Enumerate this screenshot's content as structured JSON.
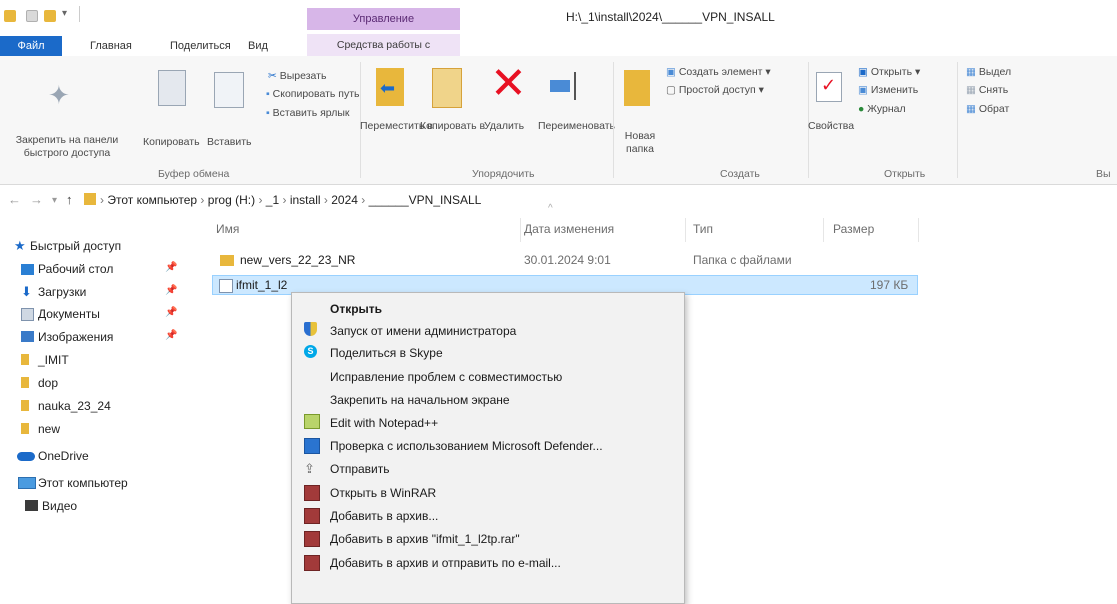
{
  "colors": {
    "accent": "#1b6ac9",
    "context_tab": "#d7b6e8",
    "selection": "#cce8ff",
    "folder": "#e8b73c",
    "delete_red": "#e81123"
  },
  "titlebar": {
    "context_tab_header": "Управление",
    "window_title": "H:\\_1\\install\\2024\\______VPN_INSALL"
  },
  "ribbon_tabs": {
    "file": "Файл",
    "home": "Главная",
    "share": "Поделиться",
    "view": "Вид",
    "app_tools": "Средства работы с приложениями"
  },
  "ribbon": {
    "clipboard": {
      "pin_quick_access": "Закрепить на панели быстрого доступа",
      "copy": "Копировать",
      "paste": "Вставить",
      "cut": "Вырезать",
      "copy_path": "Скопировать путь",
      "paste_shortcut": "Вставить ярлык",
      "group": "Буфер обмена"
    },
    "organize": {
      "move_to": "Переместить в",
      "copy_to": "Копировать в",
      "delete": "Удалить",
      "rename": "Переименовать",
      "group": "Упорядочить"
    },
    "new": {
      "new_folder": "Новая папка",
      "new_item": "Создать элемент",
      "easy_access": "Простой доступ",
      "group": "Создать"
    },
    "open": {
      "properties": "Свойства",
      "open": "Открыть",
      "edit": "Изменить",
      "history": "Журнал",
      "group": "Открыть"
    },
    "select": {
      "select_all": "Выдел",
      "select_none": "Снять",
      "invert": "Обрат",
      "group": "Вы"
    }
  },
  "address": {
    "crumbs": [
      "Этот компьютер",
      "prog (H:)",
      "_1",
      "install",
      "2024",
      "______VPN_INSALL"
    ]
  },
  "nav": {
    "items": [
      "Быстрый доступ",
      "Рабочий стол",
      "Загрузки",
      "Документы",
      "Изображения",
      "_IMIT",
      "dop",
      "nauka_23_24",
      "new",
      "OneDrive",
      "Этот компьютер",
      "Видео"
    ]
  },
  "filelist": {
    "columns": [
      "Имя",
      "Дата изменения",
      "Тип",
      "Размер"
    ],
    "rows": [
      {
        "name": "new_vers_22_23_NR",
        "date": "30.01.2024 9:01",
        "type": "Папка с файлами",
        "size": ""
      },
      {
        "name": "ifmit_1_l2",
        "date": "",
        "type": "",
        "size": "197 КБ"
      }
    ]
  },
  "context_menu": {
    "items": [
      "Открыть",
      "Запуск от имени администратора",
      "Поделиться в Skype",
      "Исправление проблем с совместимостью",
      "Закрепить на начальном экране",
      "Edit with Notepad++",
      "Проверка с использованием Microsoft Defender...",
      "Отправить",
      "Открыть в WinRAR",
      "Добавить в архив...",
      "Добавить в архив \"ifmit_1_l2tp.rar\"",
      "Добавить в архив и отправить по e-mail..."
    ]
  }
}
